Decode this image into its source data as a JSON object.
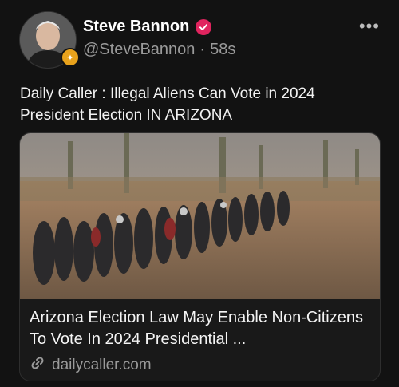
{
  "author": {
    "name": "Steve Bannon",
    "handle": "@SteveBannon",
    "separator": "·",
    "time": "58s"
  },
  "post": {
    "text": "Daily Caller : Illegal Aliens Can Vote in 2024 President Election IN ARIZONA"
  },
  "card": {
    "title": "Arizona Election Law May Enable Non-Citizens To Vote In 2024 Presidential ...",
    "domain": "dailycaller.com"
  },
  "icons": {
    "verified": "verified-badge-icon",
    "more": "more-options-icon",
    "link": "link-icon"
  },
  "colors": {
    "background": "#121212",
    "verified": "#e0245e",
    "secondary_text": "#9a9a9a"
  }
}
